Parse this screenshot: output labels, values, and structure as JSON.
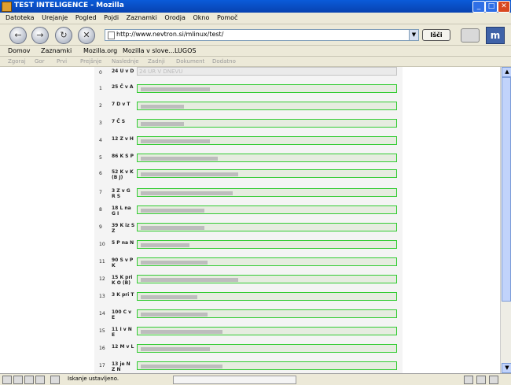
{
  "window": {
    "title": "TEST INTELIGENCE - Mozilla"
  },
  "menu": [
    "Datoteka",
    "Urejanje",
    "Pogled",
    "Pojdi",
    "Zaznamki",
    "Orodja",
    "Okno",
    "Pomoč"
  ],
  "nav": {
    "url": "http://www.nevtron.si/mlinux/test/",
    "go_label": "Išči"
  },
  "personal_toolbar": [
    "Domov",
    "Zaznamki",
    "Mozilla.org",
    "Mozilla v slove...",
    "LUGOS"
  ],
  "site_nav": [
    "Zgoraj",
    "Gor",
    "Prvi",
    "Prejšnje",
    "Naslednje",
    "Zadnji",
    "Dokument",
    "Dodatno"
  ],
  "questions": [
    {
      "num": "0",
      "label": "24 U v D",
      "value": "24 UR V DNEVU",
      "fill": 0
    },
    {
      "num": "1",
      "label": "25 Č v A",
      "value": "",
      "fill": 0.27
    },
    {
      "num": "2",
      "label": "7 D v T",
      "value": "",
      "fill": 0.17
    },
    {
      "num": "3",
      "label": "7 Č S",
      "value": "",
      "fill": 0.17
    },
    {
      "num": "4",
      "label": "12 Z v H",
      "value": "",
      "fill": 0.27
    },
    {
      "num": "5",
      "label": "86 K S P",
      "value": "",
      "fill": 0.3
    },
    {
      "num": "6",
      "label": "52 K v K (B J)",
      "value": "",
      "fill": 0.38
    },
    {
      "num": "7",
      "label": "3 Z v G R S",
      "value": "",
      "fill": 0.36
    },
    {
      "num": "8",
      "label": "18 L na G I",
      "value": "",
      "fill": 0.25
    },
    {
      "num": "9",
      "label": "39 K iz S Z",
      "value": "",
      "fill": 0.25
    },
    {
      "num": "10",
      "label": "5 P na N",
      "value": "",
      "fill": 0.19
    },
    {
      "num": "11",
      "label": "90 S v P K",
      "value": "",
      "fill": 0.26
    },
    {
      "num": "12",
      "label": "15 K pri K O (B)",
      "value": "",
      "fill": 0.38
    },
    {
      "num": "13",
      "label": "3 K pri T",
      "value": "",
      "fill": 0.22
    },
    {
      "num": "14",
      "label": "100 C v E",
      "value": "",
      "fill": 0.26
    },
    {
      "num": "15",
      "label": "11 I v N E",
      "value": "",
      "fill": 0.32
    },
    {
      "num": "16",
      "label": "12 M v L",
      "value": "",
      "fill": 0.27
    },
    {
      "num": "17",
      "label": "13 je N Z N",
      "value": "",
      "fill": 0.32
    }
  ],
  "status": {
    "text": "Iskanje ustavljeno."
  }
}
